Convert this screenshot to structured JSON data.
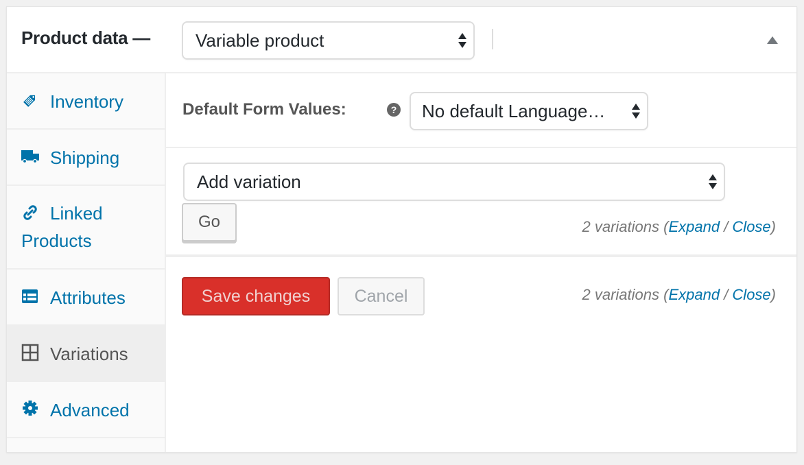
{
  "header": {
    "title": "Product data —",
    "product_type": "Variable product"
  },
  "sidebar": {
    "items": [
      {
        "label": "Inventory",
        "icon": "tag-icon",
        "active": false
      },
      {
        "label": "Shipping",
        "icon": "truck-icon",
        "active": false
      },
      {
        "label": "Linked Products",
        "icon": "link-icon",
        "active": false
      },
      {
        "label": "Attributes",
        "icon": "list-table-icon",
        "active": false
      },
      {
        "label": "Variations",
        "icon": "grid-icon",
        "active": true
      },
      {
        "label": "Advanced",
        "icon": "gear-icon",
        "active": false
      }
    ]
  },
  "main": {
    "default_form_values_label": "Default Form Values:",
    "help_icon": "?",
    "language_select": "No default Language…",
    "add_variation_select": "Add variation",
    "go_label": "Go",
    "variations_count_top": {
      "count_text": "2 variations (",
      "expand": "Expand",
      "slash": " / ",
      "close": "Close",
      "end": ")"
    },
    "save_label": "Save changes",
    "cancel_label": "Cancel",
    "variations_count_bottom": {
      "count_text": "2 variations (",
      "expand": "Expand",
      "slash": " / ",
      "close": "Close",
      "end": ")"
    }
  },
  "colors": {
    "link": "#0073aa",
    "save_button": "#d9302a",
    "active_tab_bg": "#eeeeee"
  }
}
